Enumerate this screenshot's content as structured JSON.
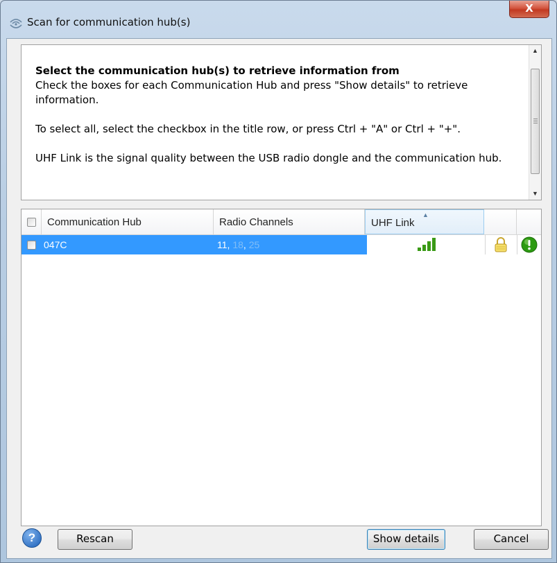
{
  "window": {
    "title": "Scan for communication hub(s)",
    "close_label": "X"
  },
  "info": {
    "heading": "Select the communication hub(s) to retrieve information from",
    "line1": "Check the boxes for each Communication Hub and press \"Show details\" to retrieve information.",
    "line2": "To select all, select the checkbox in the title row, or press Ctrl + \"A\" or Ctrl + \"+\".",
    "line3": "UHF Link is the signal quality between the USB radio dongle and the communication hub."
  },
  "grid": {
    "columns": [
      "Communication Hub",
      "Radio Channels",
      "UHF Link"
    ],
    "sorted_column": "UHF Link",
    "rows": [
      {
        "hub": "047C",
        "channels": [
          {
            "value": "11",
            "active": true
          },
          {
            "value": "18",
            "active": false
          },
          {
            "value": "25",
            "active": false
          }
        ],
        "uhf_link_bars": 3,
        "uhf_link_max_bars": 4,
        "selected": true,
        "checked": false
      }
    ]
  },
  "buttons": {
    "help": "?",
    "rescan": "Rescan",
    "show_details": "Show details",
    "cancel": "Cancel"
  },
  "colors": {
    "selection": "#3399ff",
    "signal_bar": "#3a9a16",
    "status_ok": "#2d9b12"
  }
}
